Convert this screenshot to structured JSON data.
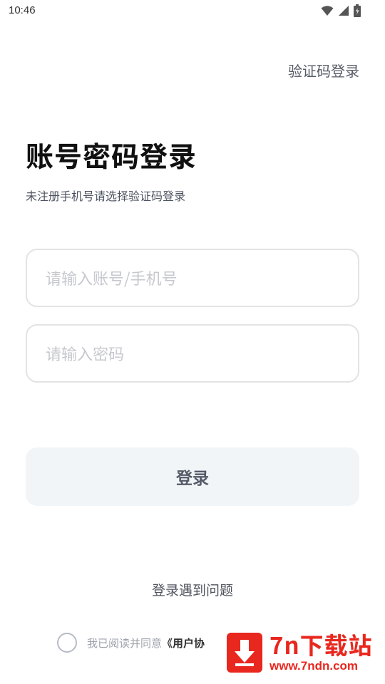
{
  "status_bar": {
    "time": "10:46",
    "icons": [
      "wifi-icon",
      "signal-icon",
      "battery-icon"
    ]
  },
  "header": {
    "switch_login_label": "验证码登录"
  },
  "main": {
    "title": "账号密码登录",
    "subtitle": "未注册手机号请选择验证码登录",
    "account_placeholder": "请输入账号/手机号",
    "password_placeholder": "请输入密码",
    "login_button_label": "登录",
    "help_link_label": "登录遇到问题"
  },
  "agreement": {
    "text": "我已阅读并同意",
    "link": "《用户协"
  },
  "watermark": {
    "title": "7n下载站",
    "url": "www.7ndn.com",
    "color": "#e8271f"
  },
  "colors": {
    "border": "#e3e3e6",
    "button_bg": "#f2f5f8",
    "placeholder": "#c7c8cf"
  }
}
